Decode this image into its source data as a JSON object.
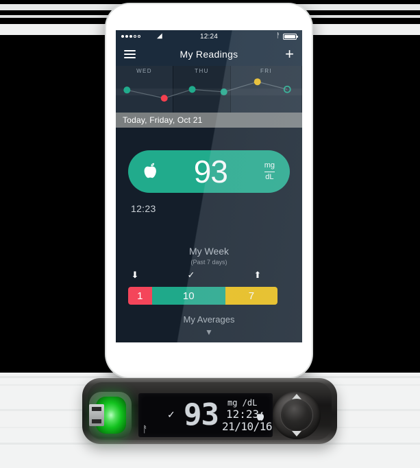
{
  "scene": {
    "background_top_color": "#000000",
    "background_bottom_color": "#f2f3f3"
  },
  "phone": {
    "status_bar": {
      "signal_dots_filled": 3,
      "signal_dots_total": 5,
      "wifi_icon": "wifi-icon",
      "time": "12:24",
      "bluetooth_icon": "bluetooth-icon",
      "battery_icon": "battery-full-icon"
    },
    "nav": {
      "menu_icon": "hamburger-menu-icon",
      "title": "My Readings",
      "add_icon": "plus-icon"
    },
    "chart_data": {
      "type": "line",
      "title": "",
      "categories": [
        "WED",
        "THU",
        "FRI"
      ],
      "tick_labels": [
        "WED",
        "THU",
        "FRI"
      ],
      "grid": false,
      "legend": "none",
      "points": [
        {
          "x": 0.06,
          "y": 0.46,
          "status": "in-range",
          "color": "#21ab8c",
          "filled": true
        },
        {
          "x": 0.26,
          "y": 0.72,
          "status": "low",
          "color": "#f5404f",
          "filled": true
        },
        {
          "x": 0.41,
          "y": 0.44,
          "status": "in-range",
          "color": "#21ab8c",
          "filled": true
        },
        {
          "x": 0.58,
          "y": 0.52,
          "status": "in-range",
          "color": "#21ab8c",
          "filled": true
        },
        {
          "x": 0.76,
          "y": 0.2,
          "status": "high",
          "color": "#f0c020",
          "filled": true
        },
        {
          "x": 0.92,
          "y": 0.44,
          "status": "current",
          "color": "#21ab8c",
          "filled": false
        }
      ],
      "target_band": {
        "from": 0.42,
        "to": 0.62
      }
    },
    "date_bar": {
      "label": "Today, Friday, Oct 21"
    },
    "reading": {
      "food_icon": "apple-icon",
      "value": "93",
      "unit_numerator": "mg",
      "unit_denominator": "dL",
      "time": "12:23",
      "status_color": "#21ab8c"
    },
    "week": {
      "title": "My Week",
      "subtitle": "(Past 7 days)",
      "icons": [
        "arrow-down-icon",
        "check-icon",
        "arrow-up-icon"
      ],
      "segments": [
        {
          "label": "1",
          "status": "low",
          "color": "#f4455a",
          "flex": 1
        },
        {
          "label": "10",
          "status": "in-range",
          "color": "#1fa98a",
          "flex": 3.1
        },
        {
          "label": "7",
          "status": "high",
          "color": "#f0c010",
          "flex": 2.2
        }
      ]
    },
    "averages": {
      "label": "My Averages",
      "chevron_icon": "chevron-down-icon"
    }
  },
  "meter": {
    "indicator_light_color": "#13c21f",
    "test_strip_icon": "test-strip-icon",
    "lcd": {
      "bluetooth_icon": "bluetooth-icon",
      "check_icon": "check-icon",
      "value": "93",
      "units": "mg /dL",
      "time": "12:23",
      "date": "21/10/16",
      "food_icon": "apple-icon"
    },
    "dpad": {
      "up_icon": "triangle-up-icon",
      "down_icon": "triangle-down-icon"
    }
  }
}
